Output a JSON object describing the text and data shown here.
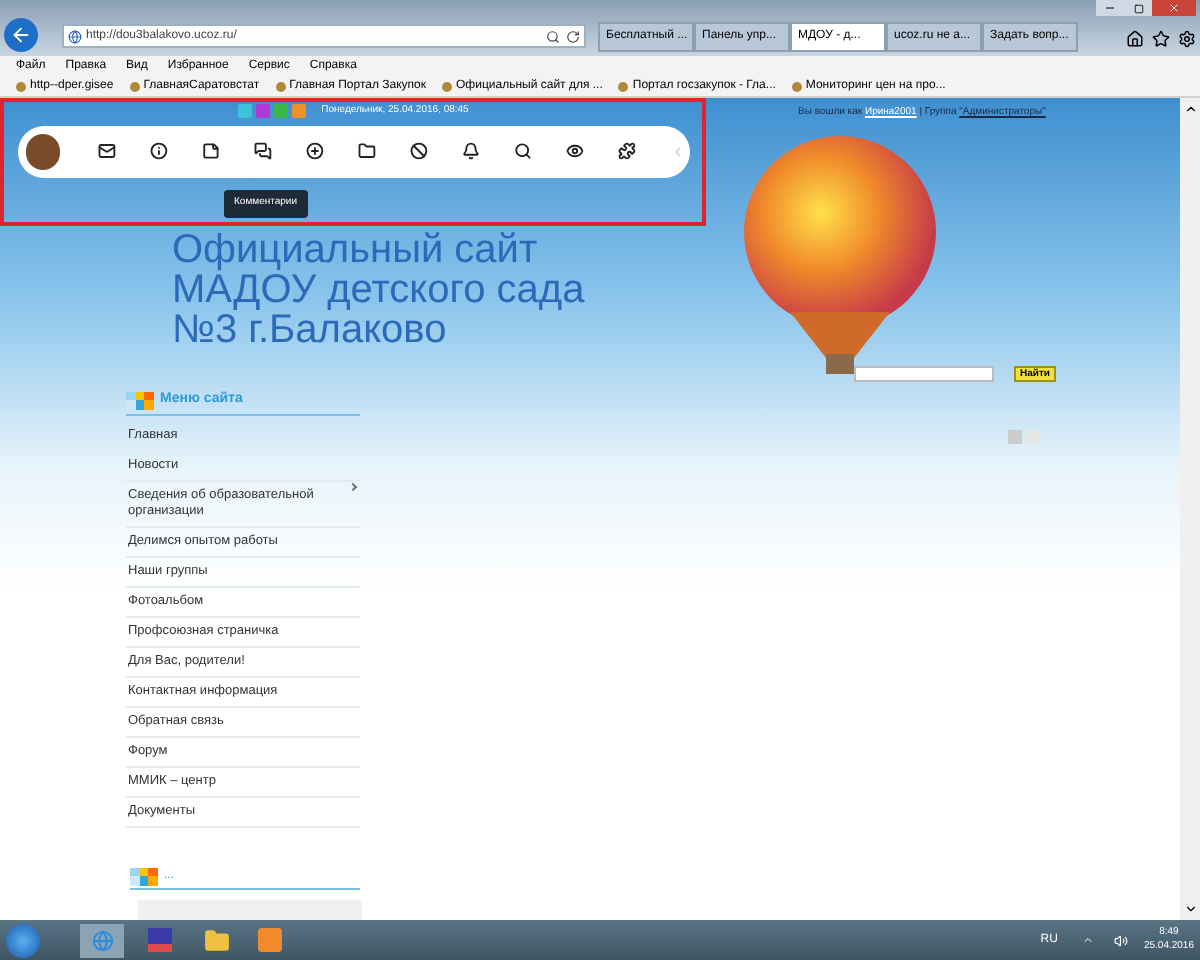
{
  "browser": {
    "address": "http://dou3balakovo.ucoz.ru/",
    "tabs": [
      {
        "label": "Бесплатный ...",
        "selected": false
      },
      {
        "label": "Панель упр...",
        "selected": false
      },
      {
        "label": "МДОУ - д...",
        "selected": true
      },
      {
        "label": "ucoz.ru не а...",
        "selected": false
      },
      {
        "label": "Задать вопр...",
        "selected": false
      }
    ],
    "menu": [
      "Файл",
      "Правка",
      "Вид",
      "Избранное",
      "Сервис",
      "Справка"
    ],
    "favorites": [
      "http--dper.gisee",
      "ГлавнаяСаратовстат",
      "Главная Портал Закупок",
      "Официальный сайт для ...",
      "Портал госзакупок - Гла...",
      "Мониторинг цен на про..."
    ]
  },
  "page": {
    "date": "Понедельник, 25.04.2016, 08:45",
    "tooltip": "Комментарии",
    "login": {
      "prefix": "Вы вошли как",
      "user": "Ирина2001",
      "group_prefix": "| Группа",
      "group": "\"Администраторы\""
    },
    "title_lines": [
      "Официальный сайт",
      "МАДОУ детского сада",
      "№3 г.Балаково"
    ],
    "search": {
      "button": "Найти"
    },
    "sidebar": {
      "title": "Меню сайта",
      "items": [
        {
          "label": "Главная",
          "has_submenu": false
        },
        {
          "label": "Новости",
          "has_submenu": false
        },
        {
          "label": "Сведения об образовательной организации",
          "has_submenu": true
        },
        {
          "label": "Делимся опытом работы",
          "has_submenu": false
        },
        {
          "label": "Наши группы",
          "has_submenu": false
        },
        {
          "label": "Фотоальбом",
          "has_submenu": false
        },
        {
          "label": "Профсоюзная страничка",
          "has_submenu": false
        },
        {
          "label": "Для Вас, родители!",
          "has_submenu": false
        },
        {
          "label": "Контактная информация",
          "has_submenu": false
        },
        {
          "label": "Обратная связь",
          "has_submenu": false
        },
        {
          "label": "Форум",
          "has_submenu": false
        },
        {
          "label": "ММИК – центр",
          "has_submenu": false
        },
        {
          "label": "Документы",
          "has_submenu": false
        }
      ]
    },
    "block2_title": "..."
  },
  "taskbar": {
    "language": "RU",
    "time": "8:49",
    "date": "25.04.2016"
  }
}
